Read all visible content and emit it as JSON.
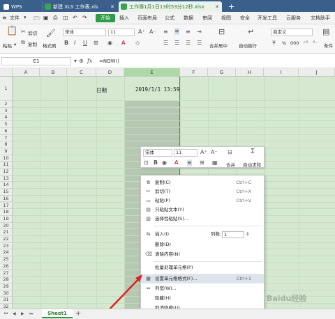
{
  "tabs": {
    "app_label": "WPS",
    "tab1": "新建 XLS 工作表.xls",
    "tab2": "工作簿1月1日13时53分12秒.xlsx",
    "add": "+"
  },
  "menu": {
    "file": "文件",
    "items": [
      "开始",
      "插入",
      "页面布局",
      "公式",
      "数据",
      "审阅",
      "视图",
      "安全",
      "开发工具",
      "云服务",
      "文档助手"
    ]
  },
  "ribbon": {
    "cut": "剪切",
    "paste": "粘贴",
    "copy": "复制",
    "format_painter": "格式刷",
    "font_name": "宋体",
    "font_size": "11",
    "merge_center": "合并居中",
    "auto_wrap": "自动换行",
    "number_format": "自定义",
    "percent": "%",
    "thousands": "000",
    "cond": "条件"
  },
  "formula_bar": {
    "name_box": "E1",
    "fx": "fx",
    "formula": "=NOW()"
  },
  "columns": [
    "A",
    "B",
    "C",
    "D",
    "E",
    "F",
    "G",
    "H",
    "I",
    "J"
  ],
  "rows": [
    "1",
    "2",
    "3",
    "4",
    "5",
    "6",
    "7",
    "8",
    "9",
    "10",
    "11",
    "12",
    "13",
    "14",
    "15",
    "16",
    "17",
    "18",
    "19",
    "20",
    "21",
    "22",
    "23",
    "24",
    "25",
    "26",
    "27",
    "28",
    "29",
    "30",
    "31",
    "32"
  ],
  "cells": {
    "d1": "日期",
    "e1": "2019/1/1 13:59"
  },
  "mini_toolbar": {
    "font": "宋体",
    "size": "11",
    "merge": "合并",
    "autosum": "自动求和"
  },
  "context_menu": {
    "copy": {
      "label": "复制(C)",
      "shortcut": "Ctrl+C"
    },
    "cut": {
      "label": "剪切(T)",
      "shortcut": "Ctrl+X"
    },
    "paste": {
      "label": "粘贴(P)",
      "shortcut": "Ctrl+V"
    },
    "paste_text": {
      "label": "只粘贴文本(Y)"
    },
    "paste_special": {
      "label": "选择性粘贴(S)..."
    },
    "insert": {
      "label": "插入(I)",
      "cols_label": "列数:",
      "cols_value": "1"
    },
    "delete": {
      "label": "删除(D)"
    },
    "clear": {
      "label": "清除内容(N)"
    },
    "batch": {
      "label": "批量处理单元格(P)"
    },
    "format_cells": {
      "label": "设置单元格格式(F)...",
      "shortcut": "Ctrl+1"
    },
    "col_width": {
      "label": "列宽(W)..."
    },
    "hide": {
      "label": "隐藏(H)"
    },
    "unhide": {
      "label": "取消隐藏(U)"
    }
  },
  "sheets": {
    "active": "Sheet1",
    "add": "+"
  },
  "watermark": "Baidu经验"
}
